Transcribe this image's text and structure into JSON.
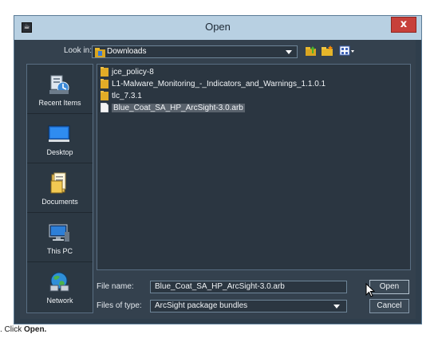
{
  "window": {
    "title": "Open",
    "close_label": "x"
  },
  "look_in": {
    "label": "Look in:",
    "value": "Downloads"
  },
  "places": [
    {
      "label": "Recent Items",
      "icon": "recent-items-icon"
    },
    {
      "label": "Desktop",
      "icon": "desktop-icon"
    },
    {
      "label": "Documents",
      "icon": "documents-icon"
    },
    {
      "label": "This PC",
      "icon": "computer-icon"
    },
    {
      "label": "Network",
      "icon": "network-icon"
    }
  ],
  "files": [
    {
      "name": "jce_policy-8",
      "type": "folder"
    },
    {
      "name": "L1-Malware_Monitoring_-_Indicators_and_Warnings_1.1.0.1",
      "type": "folder"
    },
    {
      "name": "tlc_7.3.1",
      "type": "folder"
    },
    {
      "name": "Blue_Coat_SA_HP_ArcSight-3.0.arb",
      "type": "file",
      "selected": true
    }
  ],
  "file_name": {
    "label": "File name:",
    "value": "Blue_Coat_SA_HP_ArcSight-3.0.arb"
  },
  "file_type": {
    "label": "Files of type:",
    "value": "ArcSight package bundles"
  },
  "buttons": {
    "open": "Open",
    "cancel": "Cancel"
  },
  "caption": {
    "prefix": ".  Click ",
    "bold": "Open."
  },
  "colors": {
    "window_bg": "#34414e",
    "titlebar": "#b8d0e2",
    "close": "#c7403a",
    "selection": "#59626c"
  }
}
